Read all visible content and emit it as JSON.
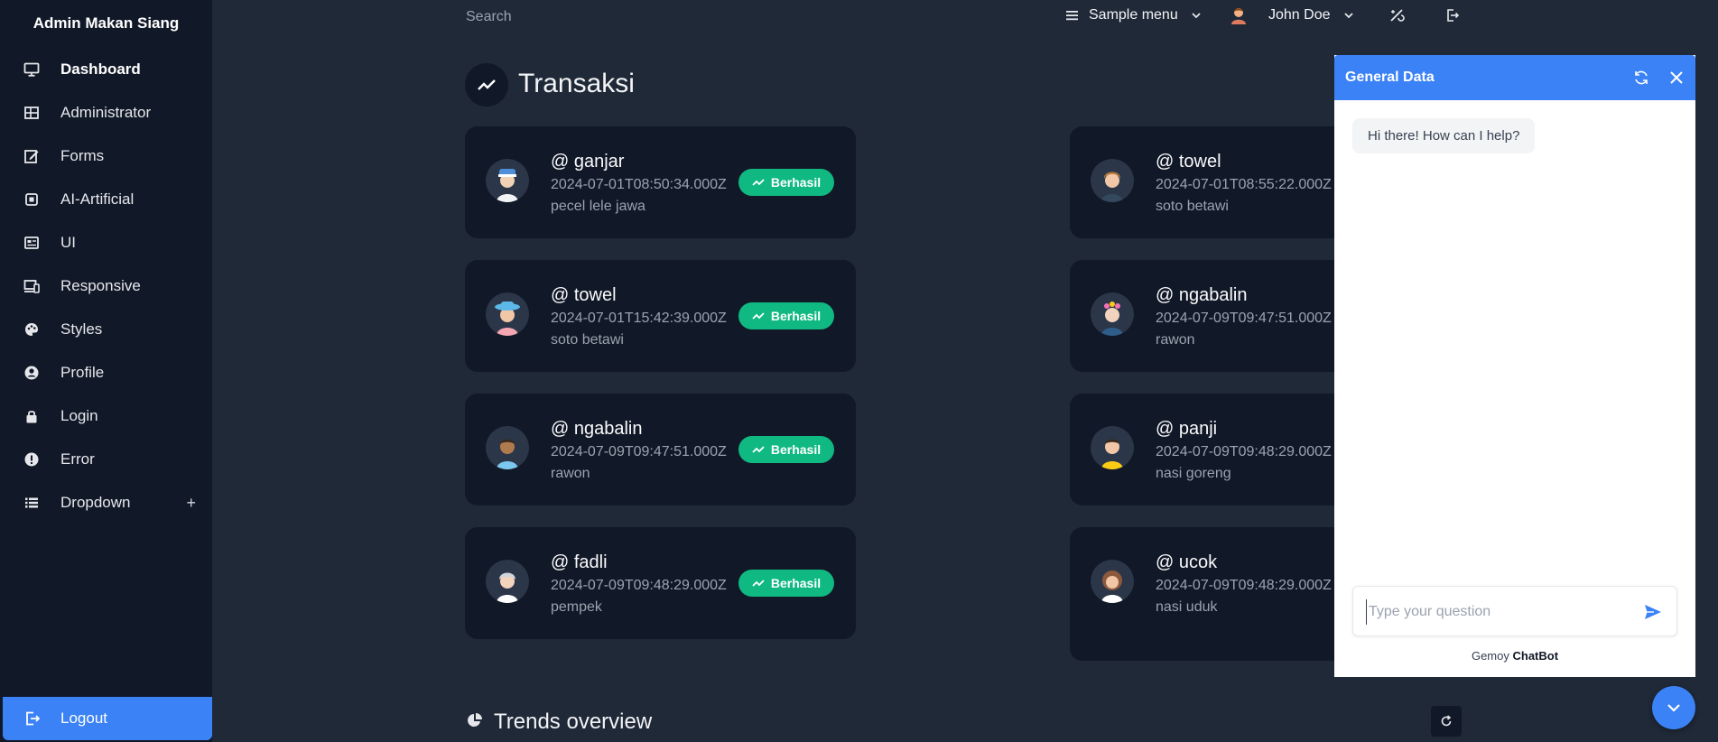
{
  "sidebar": {
    "brand": "Admin Makan Siang",
    "items": [
      {
        "label": "Dashboard",
        "icon": "monitor-icon"
      },
      {
        "label": "Administrator",
        "icon": "table-icon"
      },
      {
        "label": "Forms",
        "icon": "edit-icon"
      },
      {
        "label": "AI-Artificial",
        "icon": "chip-icon"
      },
      {
        "label": "UI",
        "icon": "card-icon"
      },
      {
        "label": "Responsive",
        "icon": "responsive-icon"
      },
      {
        "label": "Styles",
        "icon": "palette-icon"
      },
      {
        "label": "Profile",
        "icon": "user-circle-icon"
      },
      {
        "label": "Login",
        "icon": "lock-icon"
      },
      {
        "label": "Error",
        "icon": "alert-icon"
      },
      {
        "label": "Dropdown",
        "icon": "list-icon",
        "toggle": "+"
      }
    ],
    "logout": "Logout"
  },
  "topbar": {
    "search_placeholder": "Search",
    "menu_label": "Sample menu",
    "user_name": "John Doe"
  },
  "main": {
    "title": "Transaksi",
    "badge_label": "Berhasil",
    "transactions_left": [
      {
        "user": "@ ganjar",
        "time": "2024-07-01T08:50:34.000Z",
        "food": "pecel lele jawa"
      },
      {
        "user": "@ towel",
        "time": "2024-07-01T15:42:39.000Z",
        "food": "soto betawi"
      },
      {
        "user": "@ ngabalin",
        "time": "2024-07-09T09:47:51.000Z",
        "food": "rawon"
      },
      {
        "user": "@ fadli",
        "time": "2024-07-09T09:48:29.000Z",
        "food": "pempek"
      }
    ],
    "transactions_right": [
      {
        "user": "@ towel",
        "time": "2024-07-01T08:55:22.000Z",
        "food": "soto betawi"
      },
      {
        "user": "@ ngabalin",
        "time": "2024-07-09T09:47:51.000Z",
        "food": "rawon"
      },
      {
        "user": "@ panji",
        "time": "2024-07-09T09:48:29.000Z",
        "food": "nasi goreng"
      },
      {
        "user": "@ ucok",
        "time": "2024-07-09T09:48:29.000Z",
        "food": "nasi uduk"
      }
    ],
    "trends_title": "Trends overview"
  },
  "chat": {
    "title": "General Data",
    "greeting": "Hi there! How can I help?",
    "input_placeholder": "Type your question",
    "footer_brand": "Gemoy",
    "footer_product": "ChatBot"
  },
  "colors": {
    "accent": "#3b82f6",
    "success": "#10b981",
    "sidebar_bg": "#111827",
    "main_bg": "#1f2937"
  }
}
